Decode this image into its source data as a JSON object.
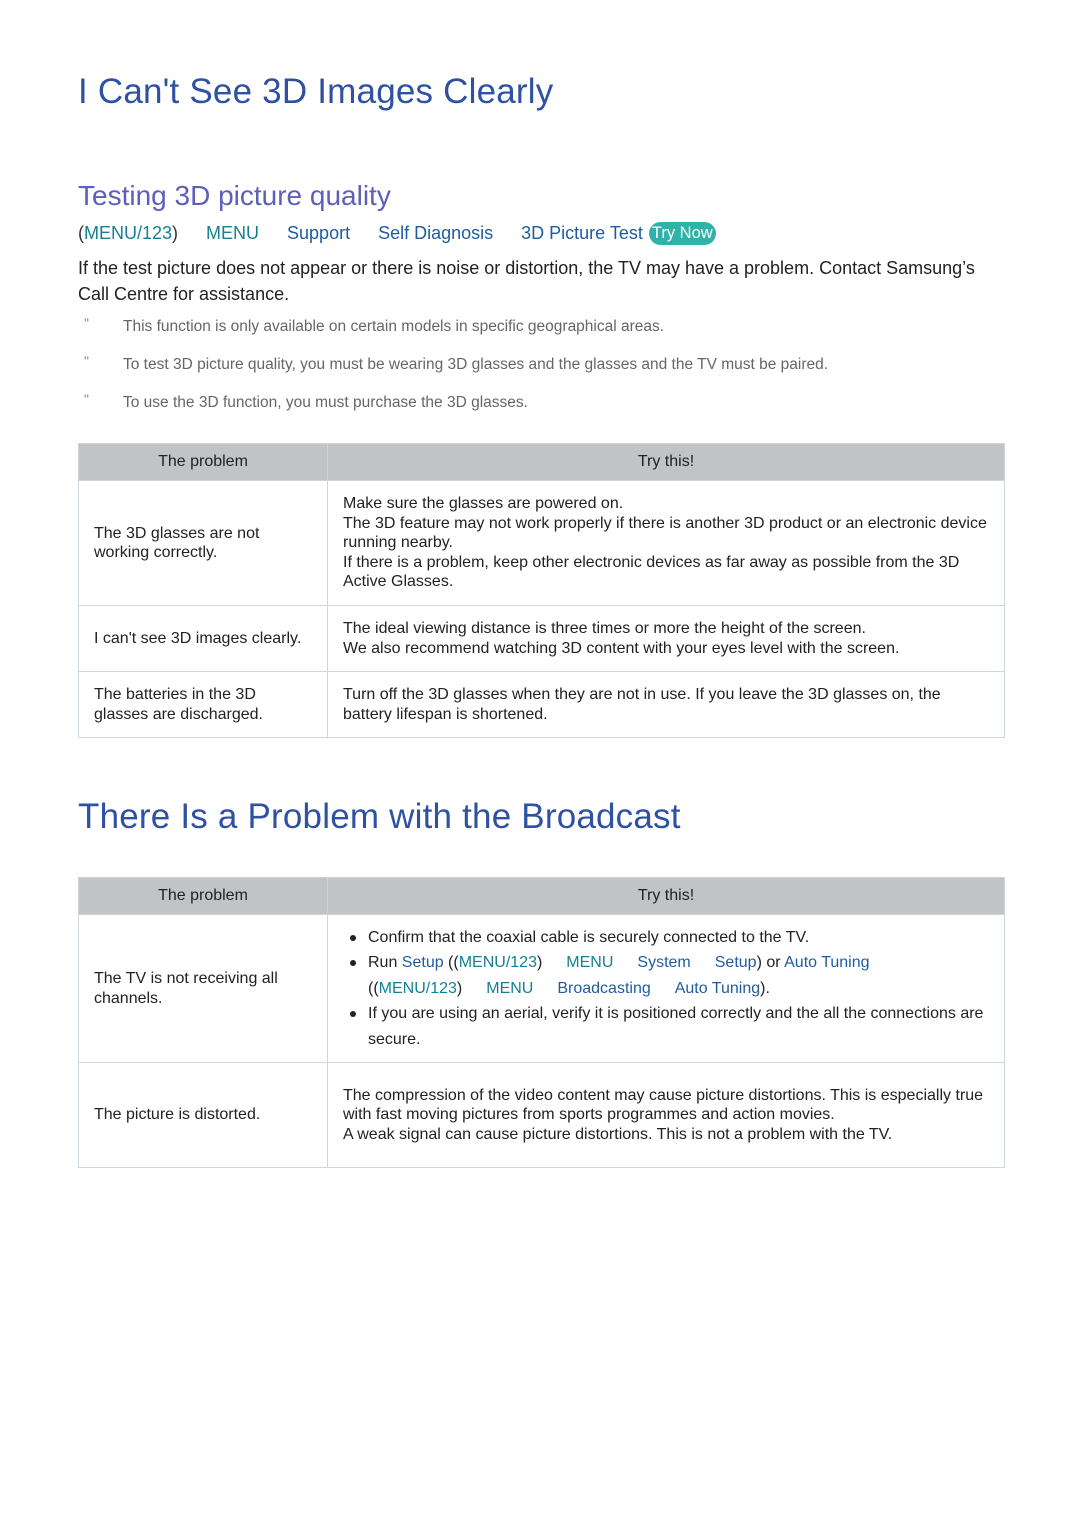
{
  "section1": {
    "title": "I Can't See 3D Images Clearly",
    "subtitle": "Testing 3D picture quality",
    "menu_path": {
      "prefix_open": "(",
      "menu123": "MENU/123",
      "prefix_close": ")",
      "items": [
        "MENU",
        "Support",
        "Self Diagnosis",
        "3D Picture Test"
      ],
      "try_now": "Try Now"
    },
    "intro": "If the test picture does not appear or there is noise or distortion, the TV may have a problem. Contact Samsung’s Call Centre for assistance.",
    "notes": [
      "This function is only available on certain models in specific geographical areas.",
      "To test 3D picture quality, you must be wearing 3D glasses and the glasses and the TV must be paired.",
      "To use the 3D function, you must purchase the 3D glasses."
    ],
    "note_mark": "\"",
    "table": {
      "headers": [
        "The problem",
        "Try this!"
      ],
      "rows": [
        {
          "problem": "The 3D glasses are not working correctly.",
          "solution": [
            "Make sure the glasses are powered on.",
            "The 3D feature may not work properly if there is another 3D product or an electronic device running nearby.",
            "If there is a problem, keep other electronic devices as far away as possible from the 3D Active Glasses."
          ]
        },
        {
          "problem": "I can't see 3D images clearly.",
          "solution": [
            "The ideal viewing distance is three times or more the height of the screen.",
            "We also recommend watching 3D content with your eyes level with the screen."
          ]
        },
        {
          "problem": "The batteries in the 3D glasses are discharged.",
          "solution": [
            "Turn off the 3D glasses when they are not in use. If you leave the 3D glasses on, the battery lifespan is shortened."
          ]
        }
      ]
    }
  },
  "section2": {
    "title": "There Is a Problem with the Broadcast",
    "table": {
      "headers": [
        "The problem",
        "Try this!"
      ],
      "row1": {
        "problem": "The TV is not receiving all channels.",
        "bullet1": "Confirm that the coaxial cable is securely connected to the TV.",
        "bullet2": {
          "run": "Run ",
          "setup": "Setup",
          "open1": " ((",
          "menu123": "MENU/123",
          "close1": ")",
          "menu": "MENU",
          "system": "System",
          "setup2": "Setup",
          "or": ") or ",
          "auto_tuning": "Auto Tuning",
          "open2": "((",
          "menu123_b": "MENU/123",
          "close2": ")",
          "menu_b": "MENU",
          "broadcasting": "Broadcasting",
          "auto_tuning_b": "Auto Tuning",
          "end": ")."
        },
        "bullet3": "If you are using an aerial, verify it is positioned correctly and the all the connections are secure."
      },
      "row2": {
        "problem": "The picture is distorted.",
        "solution": [
          "The compression of the video content may cause picture distortions. This is especially true with fast moving pictures from sports programmes and action movies.",
          "A weak signal can cause picture distortions. This is not a problem with the TV."
        ]
      }
    }
  },
  "colors": {
    "heading": "#2f51a2",
    "subheading": "#5d60b8",
    "link_blue": "#1f5c9e",
    "link_teal": "#138194",
    "try_now_bg": "#2fb3a8",
    "table_header_bg": "#c2c3c5"
  }
}
